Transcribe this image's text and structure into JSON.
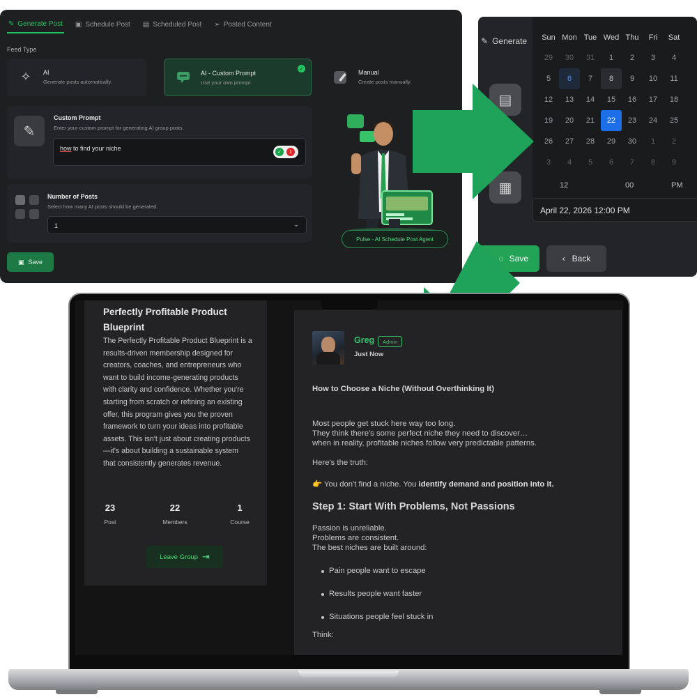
{
  "panel1": {
    "tabs": [
      {
        "label": "Generate Post",
        "icon": "pencil-icon",
        "active": true
      },
      {
        "label": "Schedule Post",
        "icon": "calendar-icon",
        "active": false
      },
      {
        "label": "Scheduled Post",
        "icon": "calendar-check-icon",
        "active": false
      },
      {
        "label": "Posted Content",
        "icon": "send-icon",
        "active": false
      }
    ],
    "feed_type_label": "Feed Type",
    "feed_options": [
      {
        "title": "AI",
        "desc": "Generate posts automatically.",
        "icon": "sparkle-icon"
      },
      {
        "title": "AI - Custom Prompt",
        "desc": "Use your own prompt.",
        "icon": "chat-icon",
        "selected": true
      },
      {
        "title": "Manual",
        "desc": "Create posts manually.",
        "icon": "edit-icon"
      }
    ],
    "custom_prompt": {
      "title": "Custom Prompt",
      "desc": "Enter your custom prompt for generating AI group posts.",
      "value_first_word": "how",
      "value_rest": " to find your niche",
      "badge_count": "1"
    },
    "number_of_posts": {
      "title": "Number of Posts",
      "desc": "Select how many AI posts should be generated.",
      "value": "1"
    },
    "save_label": "Save",
    "agent_label": "Pulse - AI Schedule Post Agent"
  },
  "panel2": {
    "generate_label": "Generate",
    "weekdays": [
      "Sun",
      "Mon",
      "Tue",
      "Wed",
      "Thu",
      "Fri",
      "Sat"
    ],
    "weeks": [
      [
        "29",
        "30",
        "31",
        "1",
        "2",
        "3",
        "4"
      ],
      [
        "5",
        "6",
        "7",
        "8",
        "9",
        "10",
        "11"
      ],
      [
        "12",
        "13",
        "14",
        "15",
        "16",
        "17",
        "18"
      ],
      [
        "19",
        "20",
        "21",
        "22",
        "23",
        "24",
        "25"
      ],
      [
        "26",
        "27",
        "28",
        "29",
        "30",
        "1",
        "2"
      ],
      [
        "3",
        "4",
        "5",
        "6",
        "7",
        "8",
        "9"
      ]
    ],
    "selected_day": "22",
    "today_day": "6",
    "time": {
      "hour": "12",
      "minute": "00",
      "period": "PM"
    },
    "datetime_value": "April 22, 2026 12:00 PM",
    "save_label": "Save",
    "back_label": "Back"
  },
  "group": {
    "title": "Perfectly Profitable Product Blueprint",
    "description": "The Perfectly Profitable Product Blueprint is a results-driven membership designed for creators, coaches, and entrepreneurs who want to build income-generating products with clarity and confidence. Whether you're starting from scratch or refining an existing offer, this program gives you the proven framework to turn your ideas into profitable assets. This isn't just about creating products—it's about building a sustainable system that consistently generates revenue.",
    "stats": [
      {
        "value": "23",
        "label": "Post"
      },
      {
        "value": "22",
        "label": "Members"
      },
      {
        "value": "1",
        "label": "Course"
      }
    ],
    "leave_label": "Leave Group"
  },
  "post": {
    "author": "Greg",
    "badge": "Admin",
    "time": "Just Now",
    "heading": "How to Choose a Niche (Without Overthinking It)",
    "para1": [
      "Most people get stuck here way too long.",
      "They think there's some perfect niche they need to discover…",
      "when in reality, profitable niches follow very predictable patterns."
    ],
    "truth": "Here's the truth:",
    "pointer_emoji": "👉",
    "insight_plain": "You don't find a niche. You ",
    "insight_bold": "identify demand and position into it.",
    "step1": "Step 1: Start With Problems, Not Passions",
    "para2": [
      "Passion is unreliable.",
      "Problems are consistent.",
      "The best niches are built around:"
    ],
    "bullets": [
      "Pain people want to escape",
      "Results people want faster",
      "Situations people feel stuck in"
    ],
    "think": "Think:"
  },
  "colors": {
    "accent_green": "#22c55e",
    "arrow_green": "#1fa35a",
    "calendar_selected": "#1d6fe8"
  }
}
